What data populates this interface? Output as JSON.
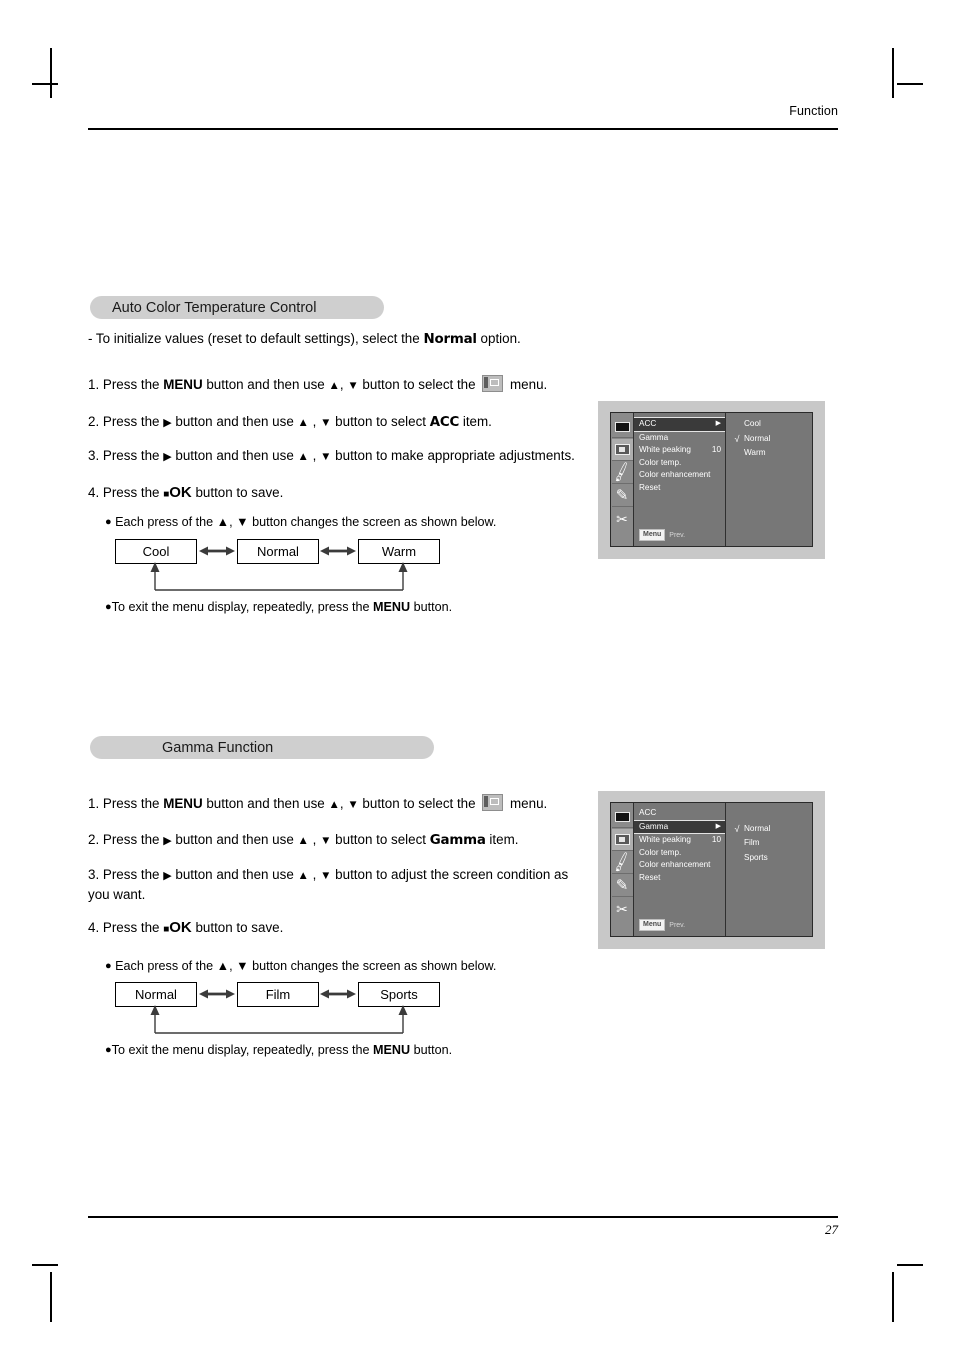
{
  "page": {
    "running_head": "Function",
    "page_number": "27"
  },
  "sections": [
    {
      "id": "auto-color-temp",
      "title": "Auto Color Temperature Control",
      "intro": {
        "prefix": "- To initialize values (reset to default settings), select the ",
        "emphasis": "Normal",
        "suffix": " option."
      },
      "steps": [
        {
          "num": "1.",
          "parts": [
            "Press the ",
            "MENU",
            " button and then use ",
            "▲",
            ", ",
            "▼",
            " button to select the ",
            "[icon]",
            " menu."
          ]
        },
        {
          "num": "2.",
          "parts": [
            "Press the ",
            "▶",
            " button and then use ",
            "▲",
            " , ",
            "▼",
            " button to select ",
            "ACC",
            " item."
          ]
        },
        {
          "num": "3.",
          "parts": [
            "Press the ",
            "▶",
            " button and then use ",
            "▲",
            " , ",
            "▼",
            " button to make appropriate adjustments."
          ]
        },
        {
          "num": "4.",
          "parts": [
            "Press the ",
            "■",
            "OK",
            " button to save."
          ]
        }
      ],
      "note_each_press": "Each press of the ▲, ▼ button changes the screen as shown below.",
      "note_exit": {
        "prefix": "To exit the menu display, repeatedly, press the ",
        "emphasis": "MENU",
        "suffix": " button."
      },
      "flow": [
        "Cool",
        "Normal",
        "Warm"
      ],
      "osd": {
        "menu_items": [
          {
            "label": "ACC",
            "value": "",
            "highlighted": true,
            "caret": true
          },
          {
            "label": "Gamma",
            "value": "",
            "highlighted": false,
            "caret": false
          },
          {
            "label": "White peaking",
            "value": "10",
            "highlighted": false,
            "caret": false
          },
          {
            "label": "Color temp.",
            "value": "",
            "highlighted": false,
            "caret": false
          },
          {
            "label": "Color enhancement",
            "value": "",
            "highlighted": false,
            "caret": false
          },
          {
            "label": "Reset",
            "value": "",
            "highlighted": false,
            "caret": false
          }
        ],
        "options": [
          {
            "label": "Cool",
            "checked": false
          },
          {
            "label": "Normal",
            "checked": true
          },
          {
            "label": "Warm",
            "checked": false
          }
        ],
        "footer_menu": "Menu",
        "footer_prev": "Prev.",
        "icons": [
          "screen-icon",
          "picture-icon",
          "brush-icon",
          "brushes-icon",
          "tools-icon"
        ],
        "selected_icon_index": 1
      }
    },
    {
      "id": "gamma-function",
      "title": "Gamma Function",
      "steps": [
        {
          "num": "1.",
          "parts": [
            "Press the ",
            "MENU",
            " button and then use ",
            "▲",
            ", ",
            "▼",
            " button to select the ",
            "[icon]",
            " menu."
          ]
        },
        {
          "num": "2.",
          "parts": [
            "Press the ",
            "▶",
            " button and then use ",
            "▲",
            " , ",
            "▼",
            " button to select ",
            "Gamma",
            " item."
          ]
        },
        {
          "num": "3.",
          "parts": [
            "Press the ",
            "▶",
            " button and then use ",
            "▲",
            " , ",
            "▼",
            " button to adjust the screen condition as you want."
          ]
        },
        {
          "num": "4.",
          "parts": [
            "Press the ",
            "■",
            "OK",
            " button to save."
          ]
        }
      ],
      "note_each_press": "Each press of the ▲, ▼ button changes the screen as shown below.",
      "note_exit": {
        "prefix": "To exit the menu display, repeatedly, press the ",
        "emphasis": "MENU",
        "suffix": " button."
      },
      "flow": [
        "Normal",
        "Film",
        "Sports"
      ],
      "osd": {
        "menu_items": [
          {
            "label": "ACC",
            "value": "",
            "highlighted": false,
            "caret": false
          },
          {
            "label": "Gamma",
            "value": "",
            "highlighted": true,
            "caret": true
          },
          {
            "label": "White peaking",
            "value": "10",
            "highlighted": false,
            "caret": false
          },
          {
            "label": "Color temp.",
            "value": "",
            "highlighted": false,
            "caret": false
          },
          {
            "label": "Color enhancement",
            "value": "",
            "highlighted": false,
            "caret": false
          },
          {
            "label": "Reset",
            "value": "",
            "highlighted": false,
            "caret": false
          }
        ],
        "options": [
          {
            "label": "Normal",
            "checked": true
          },
          {
            "label": "Film",
            "checked": false
          },
          {
            "label": "Sports",
            "checked": false
          }
        ],
        "footer_menu": "Menu",
        "footer_prev": "Prev.",
        "icons": [
          "screen-icon",
          "picture-icon",
          "brush-icon",
          "brushes-icon",
          "tools-icon"
        ],
        "selected_icon_index": 1
      }
    }
  ],
  "glyphs": {
    "up": "▲",
    "down": "▼",
    "right": "▶",
    "square": "■",
    "bullet": "●",
    "check": "√"
  },
  "colors": {
    "pill_bg": "#cfcfcf",
    "osd_bezel": "#c8c8c8",
    "osd_bg": "#777777",
    "osd_iconbar": "#8b8b8b",
    "osd_highlight": "#3a3a3a",
    "text": "#000000"
  }
}
